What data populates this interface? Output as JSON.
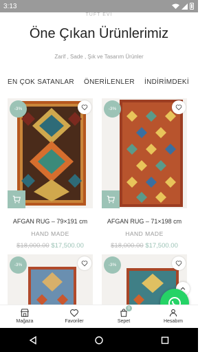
{
  "status": {
    "time": "3:13"
  },
  "header": {
    "brand": "TUFT EVI",
    "title": "Öne Çıkan Ürünlerimiz",
    "subtitle": "Zarif , Sade , Şık ve Tasarım Ürünler"
  },
  "tabs": [
    "EN ÇOK SATANLAR",
    "ÖNERİLENLER",
    "İNDİRİMDEKİ"
  ],
  "products": [
    {
      "discount": "-3%",
      "name": "AFGAN RUG – 79×191 cm",
      "tag": "HAND MADE",
      "old_price": "$18,000.00",
      "price": "$17,500.00"
    },
    {
      "discount": "-3%",
      "name": "AFGAN RUG – 71×198 cm",
      "tag": "HAND MADE",
      "old_price": "$18,000.00",
      "price": "$17,500.00"
    },
    {
      "discount": "-3%"
    },
    {
      "discount": "-3%"
    }
  ],
  "nav": {
    "items": [
      {
        "label": "Mağaza",
        "icon": "store-icon"
      },
      {
        "label": "Favoriler",
        "icon": "heart-icon"
      },
      {
        "label": "Sepet",
        "icon": "bag-icon",
        "badge": "0"
      },
      {
        "label": "Hesabım",
        "icon": "user-icon"
      }
    ]
  },
  "colors": {
    "accent": "#9cc3b6",
    "whatsapp": "#25d366"
  }
}
